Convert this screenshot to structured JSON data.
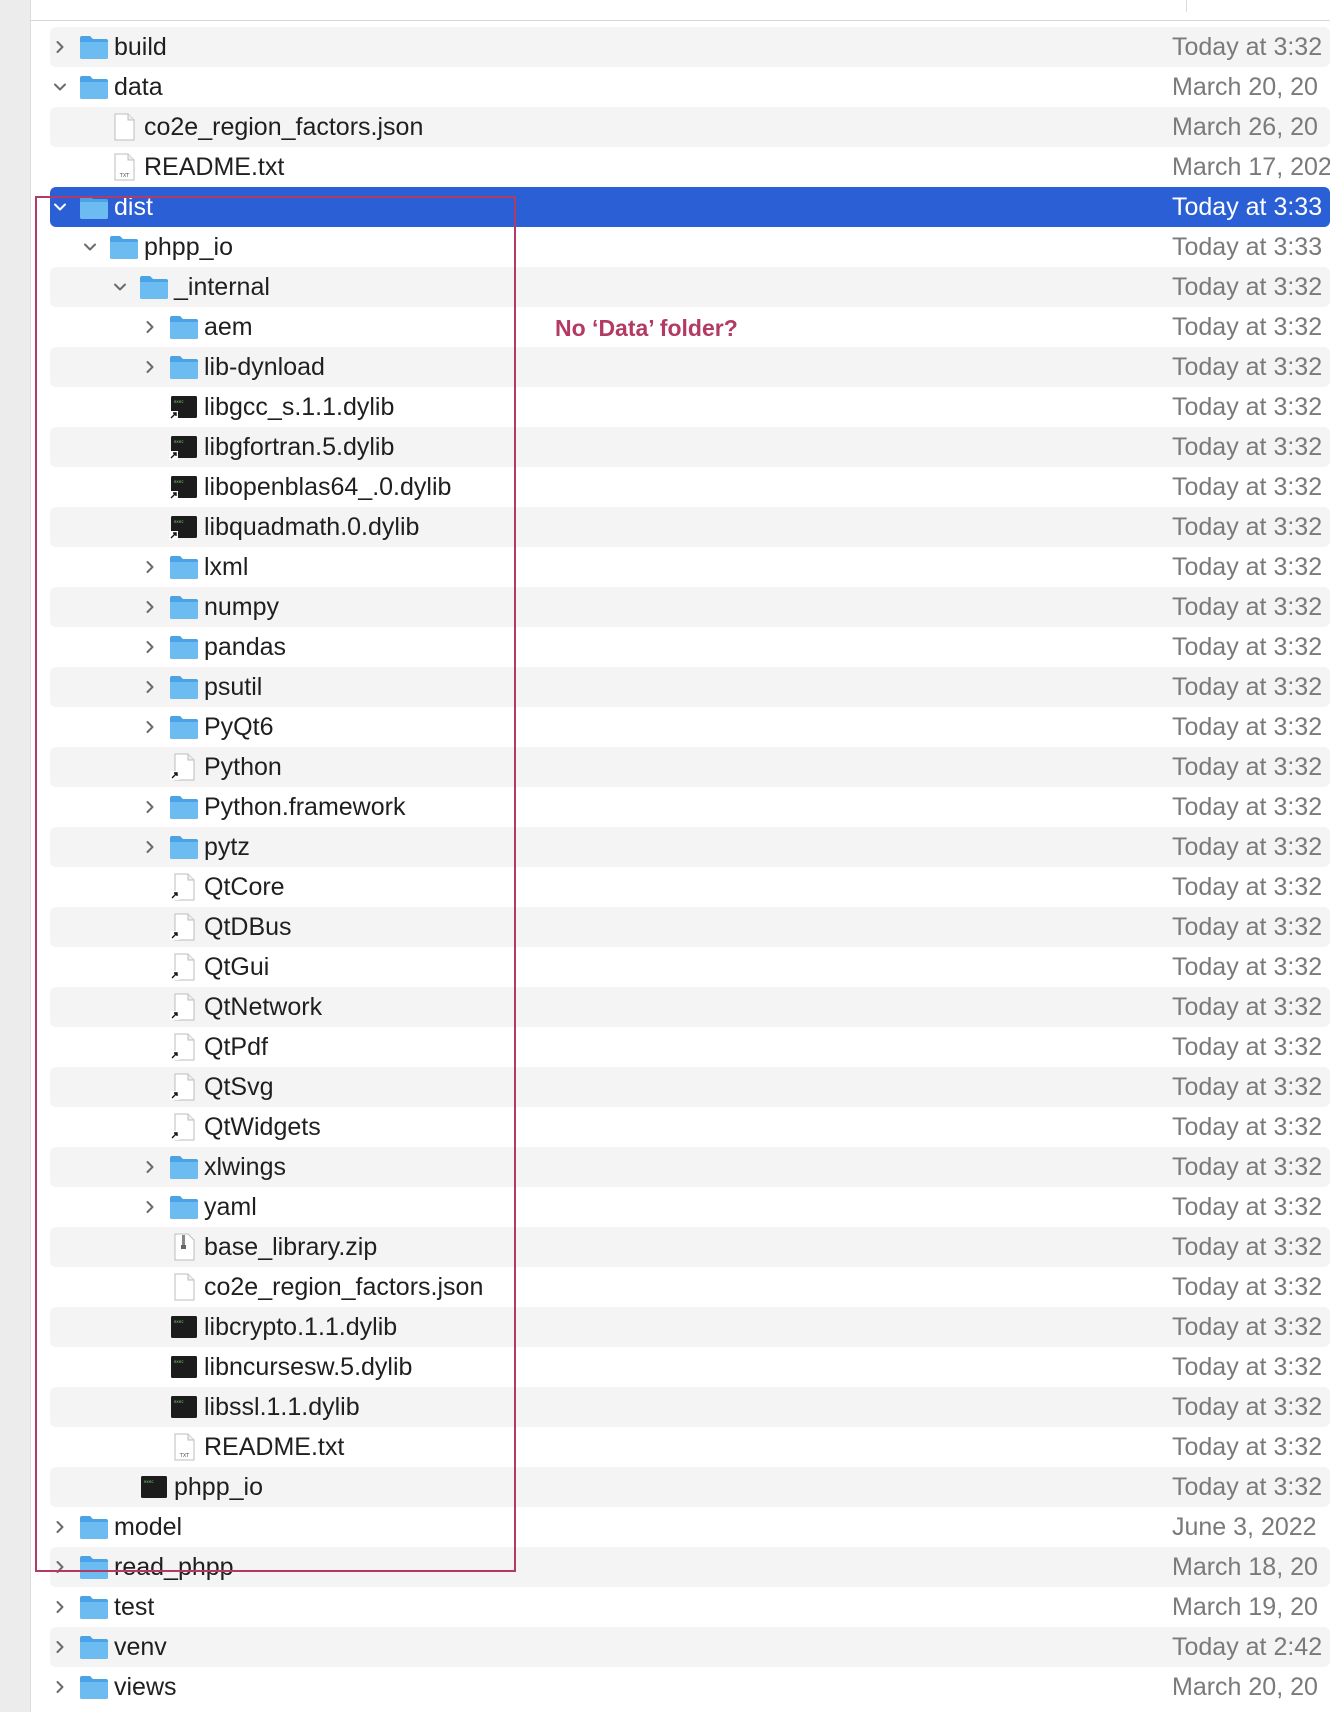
{
  "colors": {
    "selection": "#2a5fd6",
    "annotation": "#b23a63",
    "folder": "#5eb4f0",
    "stripe": "#f4f4f4"
  },
  "annotation": {
    "note": "No ‘Data’ folder?"
  },
  "rows": [
    {
      "name": "build",
      "date": "Today at 3:32",
      "depth": 0,
      "icon": "folder-icon",
      "chevron": "right"
    },
    {
      "name": "data",
      "date": "March 20, 20",
      "depth": 0,
      "icon": "folder-icon",
      "chevron": "down"
    },
    {
      "name": "co2e_region_factors.json",
      "date": "March 26, 20",
      "depth": 1,
      "icon": "file-icon",
      "chevron": ""
    },
    {
      "name": "README.txt",
      "date": "March 17, 202",
      "depth": 1,
      "icon": "txt-file-icon",
      "chevron": ""
    },
    {
      "name": "dist",
      "date": "Today at 3:33",
      "depth": 0,
      "icon": "folder-icon",
      "chevron": "down",
      "selected": true
    },
    {
      "name": "phpp_io",
      "date": "Today at 3:33",
      "depth": 1,
      "icon": "folder-icon",
      "chevron": "down"
    },
    {
      "name": "_internal",
      "date": "Today at 3:32",
      "depth": 2,
      "icon": "folder-icon",
      "chevron": "down"
    },
    {
      "name": "aem",
      "date": "Today at 3:32",
      "depth": 3,
      "icon": "folder-icon",
      "chevron": "right"
    },
    {
      "name": "lib-dynload",
      "date": "Today at 3:32",
      "depth": 3,
      "icon": "folder-icon",
      "chevron": "right"
    },
    {
      "name": "libgcc_s.1.1.dylib",
      "date": "Today at 3:32",
      "depth": 3,
      "icon": "alias-exec-icon",
      "chevron": ""
    },
    {
      "name": "libgfortran.5.dylib",
      "date": "Today at 3:32",
      "depth": 3,
      "icon": "alias-exec-icon",
      "chevron": ""
    },
    {
      "name": "libopenblas64_.0.dylib",
      "date": "Today at 3:32",
      "depth": 3,
      "icon": "alias-exec-icon",
      "chevron": ""
    },
    {
      "name": "libquadmath.0.dylib",
      "date": "Today at 3:32",
      "depth": 3,
      "icon": "alias-exec-icon",
      "chevron": ""
    },
    {
      "name": "lxml",
      "date": "Today at 3:32",
      "depth": 3,
      "icon": "folder-icon",
      "chevron": "right"
    },
    {
      "name": "numpy",
      "date": "Today at 3:32",
      "depth": 3,
      "icon": "folder-icon",
      "chevron": "right"
    },
    {
      "name": "pandas",
      "date": "Today at 3:32",
      "depth": 3,
      "icon": "folder-icon",
      "chevron": "right"
    },
    {
      "name": "psutil",
      "date": "Today at 3:32",
      "depth": 3,
      "icon": "folder-icon",
      "chevron": "right"
    },
    {
      "name": "PyQt6",
      "date": "Today at 3:32",
      "depth": 3,
      "icon": "folder-icon",
      "chevron": "right"
    },
    {
      "name": "Python",
      "date": "Today at 3:32",
      "depth": 3,
      "icon": "alias-file-icon",
      "chevron": ""
    },
    {
      "name": "Python.framework",
      "date": "Today at 3:32",
      "depth": 3,
      "icon": "folder-icon",
      "chevron": "right"
    },
    {
      "name": "pytz",
      "date": "Today at 3:32",
      "depth": 3,
      "icon": "folder-icon",
      "chevron": "right"
    },
    {
      "name": "QtCore",
      "date": "Today at 3:32",
      "depth": 3,
      "icon": "alias-file-icon",
      "chevron": ""
    },
    {
      "name": "QtDBus",
      "date": "Today at 3:32",
      "depth": 3,
      "icon": "alias-file-icon",
      "chevron": ""
    },
    {
      "name": "QtGui",
      "date": "Today at 3:32",
      "depth": 3,
      "icon": "alias-file-icon",
      "chevron": ""
    },
    {
      "name": "QtNetwork",
      "date": "Today at 3:32",
      "depth": 3,
      "icon": "alias-file-icon",
      "chevron": ""
    },
    {
      "name": "QtPdf",
      "date": "Today at 3:32",
      "depth": 3,
      "icon": "alias-file-icon",
      "chevron": ""
    },
    {
      "name": "QtSvg",
      "date": "Today at 3:32",
      "depth": 3,
      "icon": "alias-file-icon",
      "chevron": ""
    },
    {
      "name": "QtWidgets",
      "date": "Today at 3:32",
      "depth": 3,
      "icon": "alias-file-icon",
      "chevron": ""
    },
    {
      "name": "xlwings",
      "date": "Today at 3:32",
      "depth": 3,
      "icon": "folder-icon",
      "chevron": "right"
    },
    {
      "name": "yaml",
      "date": "Today at 3:32",
      "depth": 3,
      "icon": "folder-icon",
      "chevron": "right"
    },
    {
      "name": "base_library.zip",
      "date": "Today at 3:32",
      "depth": 3,
      "icon": "zip-file-icon",
      "chevron": ""
    },
    {
      "name": "co2e_region_factors.json",
      "date": "Today at 3:32",
      "depth": 3,
      "icon": "file-icon",
      "chevron": ""
    },
    {
      "name": "libcrypto.1.1.dylib",
      "date": "Today at 3:32",
      "depth": 3,
      "icon": "exec-icon",
      "chevron": ""
    },
    {
      "name": "libncursesw.5.dylib",
      "date": "Today at 3:32",
      "depth": 3,
      "icon": "exec-icon",
      "chevron": ""
    },
    {
      "name": "libssl.1.1.dylib",
      "date": "Today at 3:32",
      "depth": 3,
      "icon": "exec-icon",
      "chevron": ""
    },
    {
      "name": "README.txt",
      "date": "Today at 3:32",
      "depth": 3,
      "icon": "txt-file-icon",
      "chevron": ""
    },
    {
      "name": "phpp_io",
      "date": "Today at 3:32",
      "depth": 2,
      "icon": "exec-icon",
      "chevron": ""
    },
    {
      "name": "model",
      "date": "June 3, 2022",
      "depth": 0,
      "icon": "folder-icon",
      "chevron": "right"
    },
    {
      "name": "read_phpp",
      "date": "March 18, 20",
      "depth": 0,
      "icon": "folder-icon",
      "chevron": "right"
    },
    {
      "name": "test",
      "date": "March 19, 20",
      "depth": 0,
      "icon": "folder-icon",
      "chevron": "right"
    },
    {
      "name": "venv",
      "date": "Today at 2:42",
      "depth": 0,
      "icon": "folder-icon",
      "chevron": "right"
    },
    {
      "name": "views",
      "date": "March 20, 20",
      "depth": 0,
      "icon": "folder-icon",
      "chevron": "right"
    }
  ]
}
